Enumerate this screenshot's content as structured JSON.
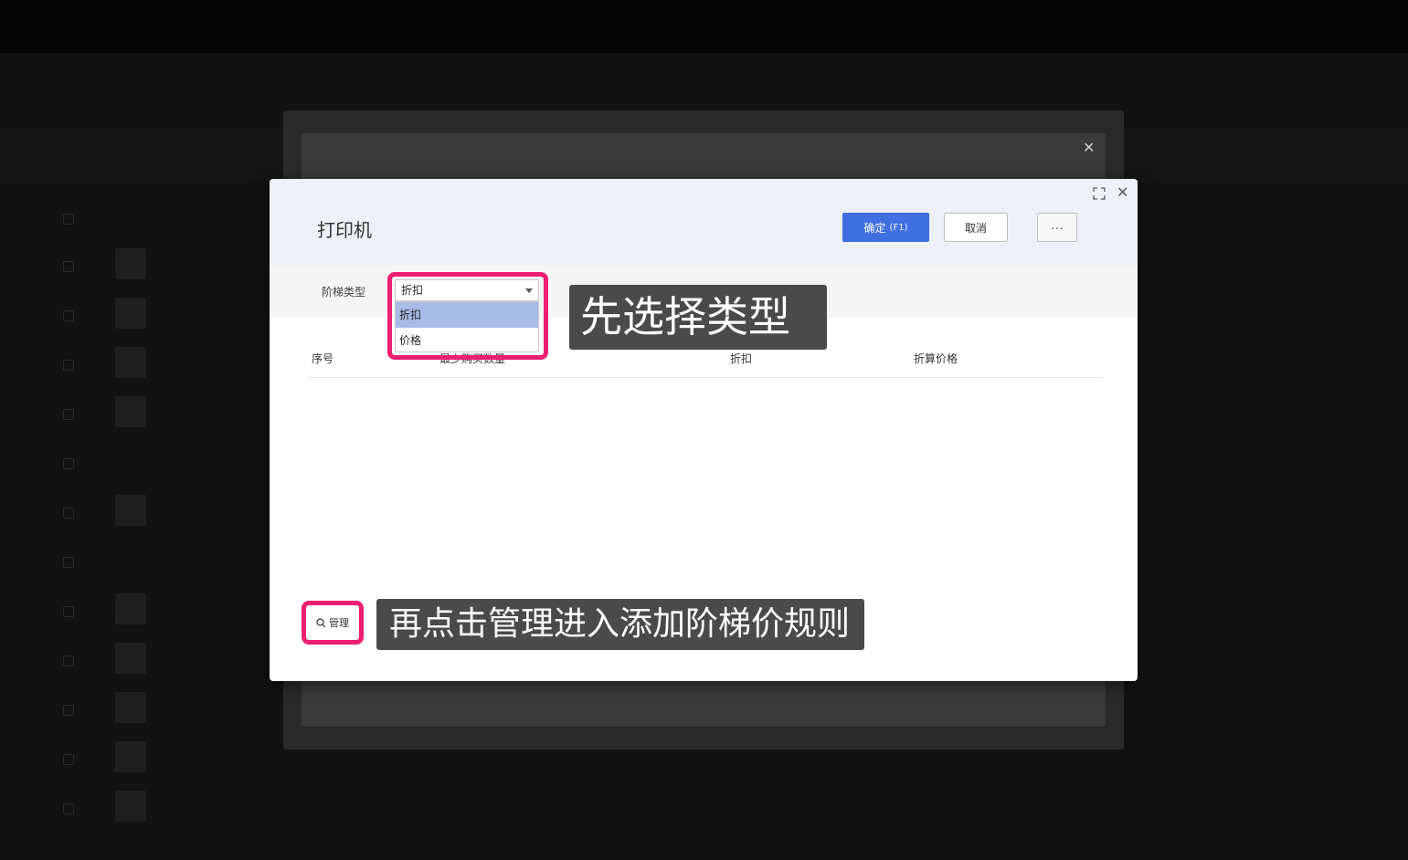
{
  "dialog": {
    "title": "打印机",
    "confirm_label": "确定",
    "confirm_hint": "(F1)",
    "cancel_label": "取消",
    "more_label": "···"
  },
  "filter": {
    "label": "阶梯类型",
    "selected": "折扣",
    "options": [
      "折扣",
      "价格"
    ]
  },
  "table": {
    "columns": [
      "序号",
      "最少购买数量",
      "折扣",
      "折算价格"
    ]
  },
  "manage_button": {
    "label": "管理"
  },
  "annotations": {
    "step1": "先选择类型",
    "step2": "再点击管理进入添加阶梯价规则"
  },
  "colors": {
    "highlight": "#ec1f72",
    "primary": "#3f6fe0",
    "annotation_bg": "#4a4a4a"
  }
}
